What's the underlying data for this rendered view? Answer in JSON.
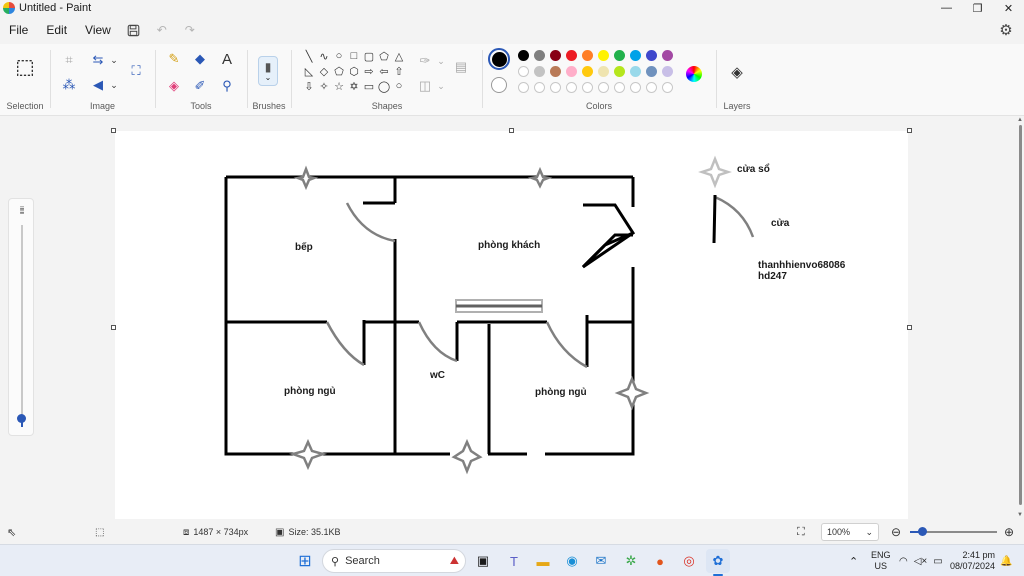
{
  "window": {
    "title": "Untitled - Paint",
    "controls": [
      "minimize-icon",
      "restore-icon",
      "close-icon"
    ]
  },
  "menu": {
    "items": [
      "File",
      "Edit",
      "View"
    ]
  },
  "ribbon": {
    "groups": {
      "selection": "Selection",
      "image": "Image",
      "tools": "Tools",
      "brushes": "Brushes",
      "shapes": "Shapes",
      "colors": "Colors",
      "layers": "Layers"
    },
    "colors_row1": [
      "#000000",
      "#7f7f7f",
      "#880015",
      "#ed1c24",
      "#ff7f27",
      "#fff200",
      "#22b14c",
      "#00a2e8",
      "#3f48cc",
      "#a349a4"
    ],
    "colors_row2": [
      "#ffffff",
      "#c3c3c3",
      "#b97a57",
      "#ffaec9",
      "#ffc90e",
      "#efe4b0",
      "#b5e61d",
      "#99d9ea",
      "#7092be",
      "#c8bfe7"
    ],
    "primary_color": "#000000",
    "secondary_color": "#ffffff"
  },
  "drawing": {
    "labels": {
      "kitchen": "bếp",
      "living_room": "phòng khách",
      "bedroom_left": "phòng ngủ",
      "wc": "wC",
      "bedroom_right": "phòng ngủ",
      "legend_window": "cửa sổ",
      "legend_door": "cửa",
      "author_line1": "thanhhienvo68086",
      "author_line2": "hd247"
    }
  },
  "status": {
    "canvas_size": "1487 × 734px",
    "file_size": "Size: 35.1KB",
    "zoom": "100%"
  },
  "taskbar": {
    "search_placeholder": "Search",
    "language": "ENG",
    "region": "US",
    "time": "2:41 pm",
    "date": "08/07/2024"
  }
}
